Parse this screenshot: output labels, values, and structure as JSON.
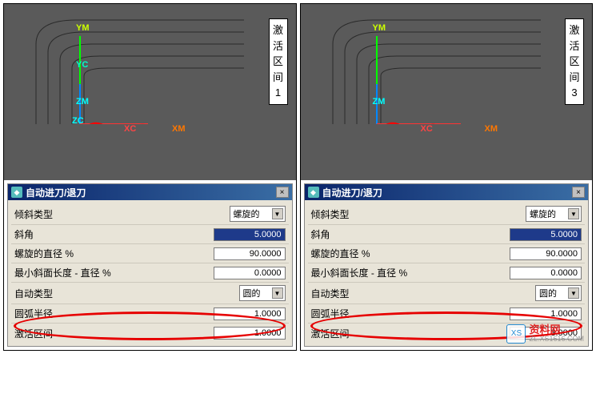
{
  "annotation": {
    "text": "激活区间",
    "value_left": "1",
    "value_right": "3"
  },
  "viewport": {
    "axes": {
      "ym": "YM",
      "yc": "YC",
      "zm": "ZM",
      "zc": "ZC",
      "xc": "XC",
      "xm": "XM"
    }
  },
  "dialog": {
    "title": "自动进刀/退刀",
    "close": "×"
  },
  "form": {
    "tilt_type": {
      "label": "倾斜类型",
      "value": "螺旋的"
    },
    "slope_angle": {
      "label": "斜角",
      "value": "5.0000"
    },
    "helix_diameter": {
      "label": "螺旋的直径 %",
      "value": "90.0000"
    },
    "min_slope_length": {
      "label": "最小斜面长度 - 直径 %",
      "value": "0.0000"
    },
    "auto_type": {
      "label": "自动类型",
      "value": "圆的"
    },
    "arc_radius": {
      "label": "圆弧半径",
      "value": "1.0000"
    },
    "activation_interval": {
      "label": "激活区间",
      "value_left": "1.0000",
      "value_right": "3.0000"
    }
  },
  "watermark": {
    "logo": "XS",
    "cn": "资料网",
    "url": "ZL.XS1616.COM"
  }
}
